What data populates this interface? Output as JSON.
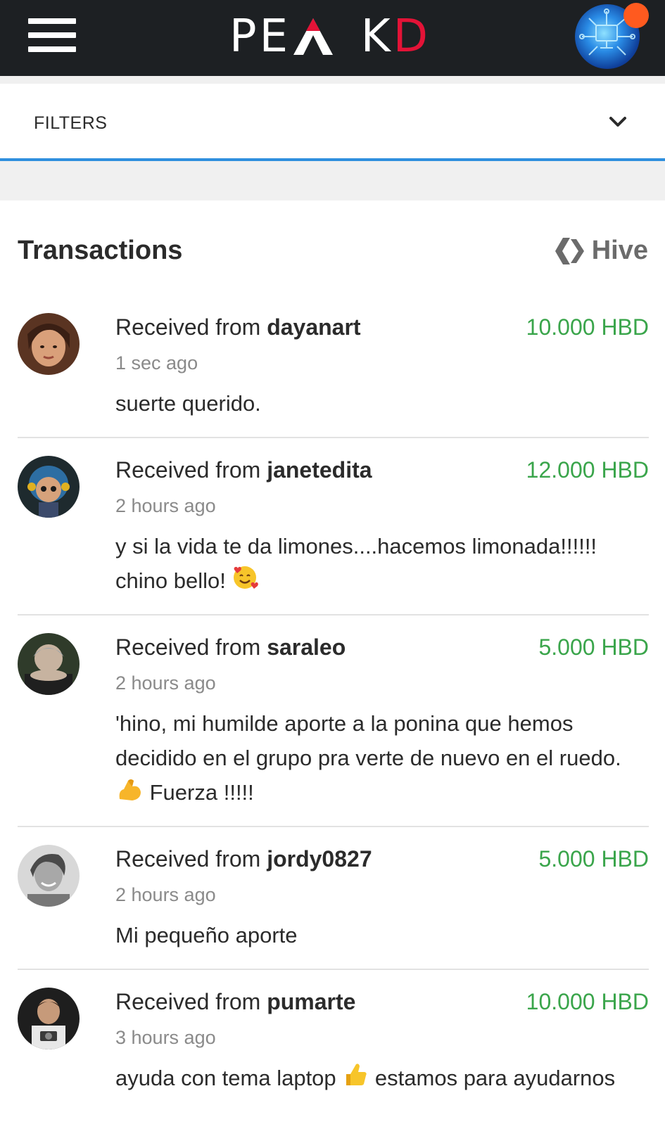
{
  "header": {
    "logo_left": "PE",
    "logo_accent": "",
    "logo_mid": "AK",
    "logo_right": "D",
    "menu_icon": "hamburger-menu-icon",
    "avatar_icon": "user-avatar",
    "notification_color": "#ff5a1f"
  },
  "filters": {
    "label": "FILTERS",
    "chevron_icon": "chevron-down-icon"
  },
  "transactions": {
    "title": "Transactions",
    "currency_label": "Hive",
    "currency_icon": "hive-logo-icon",
    "items": [
      {
        "prefix": "Received from ",
        "user": "dayanart",
        "amount": "10.000 HBD",
        "time": "1 sec ago",
        "memo": "suerte querido."
      },
      {
        "prefix": "Received from ",
        "user": "janetedita",
        "amount": "12.000 HBD",
        "time": "2 hours ago",
        "memo": "y si la vida te da limones....hacemos limonada!!!!!! chino bello!"
      },
      {
        "prefix": "Received from ",
        "user": "saraleo",
        "amount": "5.000 HBD",
        "time": "2 hours ago",
        "memo": "'hino, mi humilde aporte a la ponina que hemos decidido en el grupo pra verte de nuevo en el ruedo.",
        "memo_tail": "Fuerza !!!!!"
      },
      {
        "prefix": "Received from ",
        "user": "jordy0827",
        "amount": "5.000 HBD",
        "time": "2 hours ago",
        "memo": "Mi pequeño aporte"
      },
      {
        "prefix": "Received from ",
        "user": "pumarte",
        "amount": "10.000 HBD",
        "time": "3 hours ago",
        "memo_pre": "ayuda con tema laptop",
        "memo_post": "estamos para ayudarnos"
      }
    ]
  },
  "colors": {
    "header_bg": "#1d2023",
    "brand_red": "#e31337",
    "amount_green": "#3aa54b",
    "filter_underline": "#2f8fde"
  }
}
